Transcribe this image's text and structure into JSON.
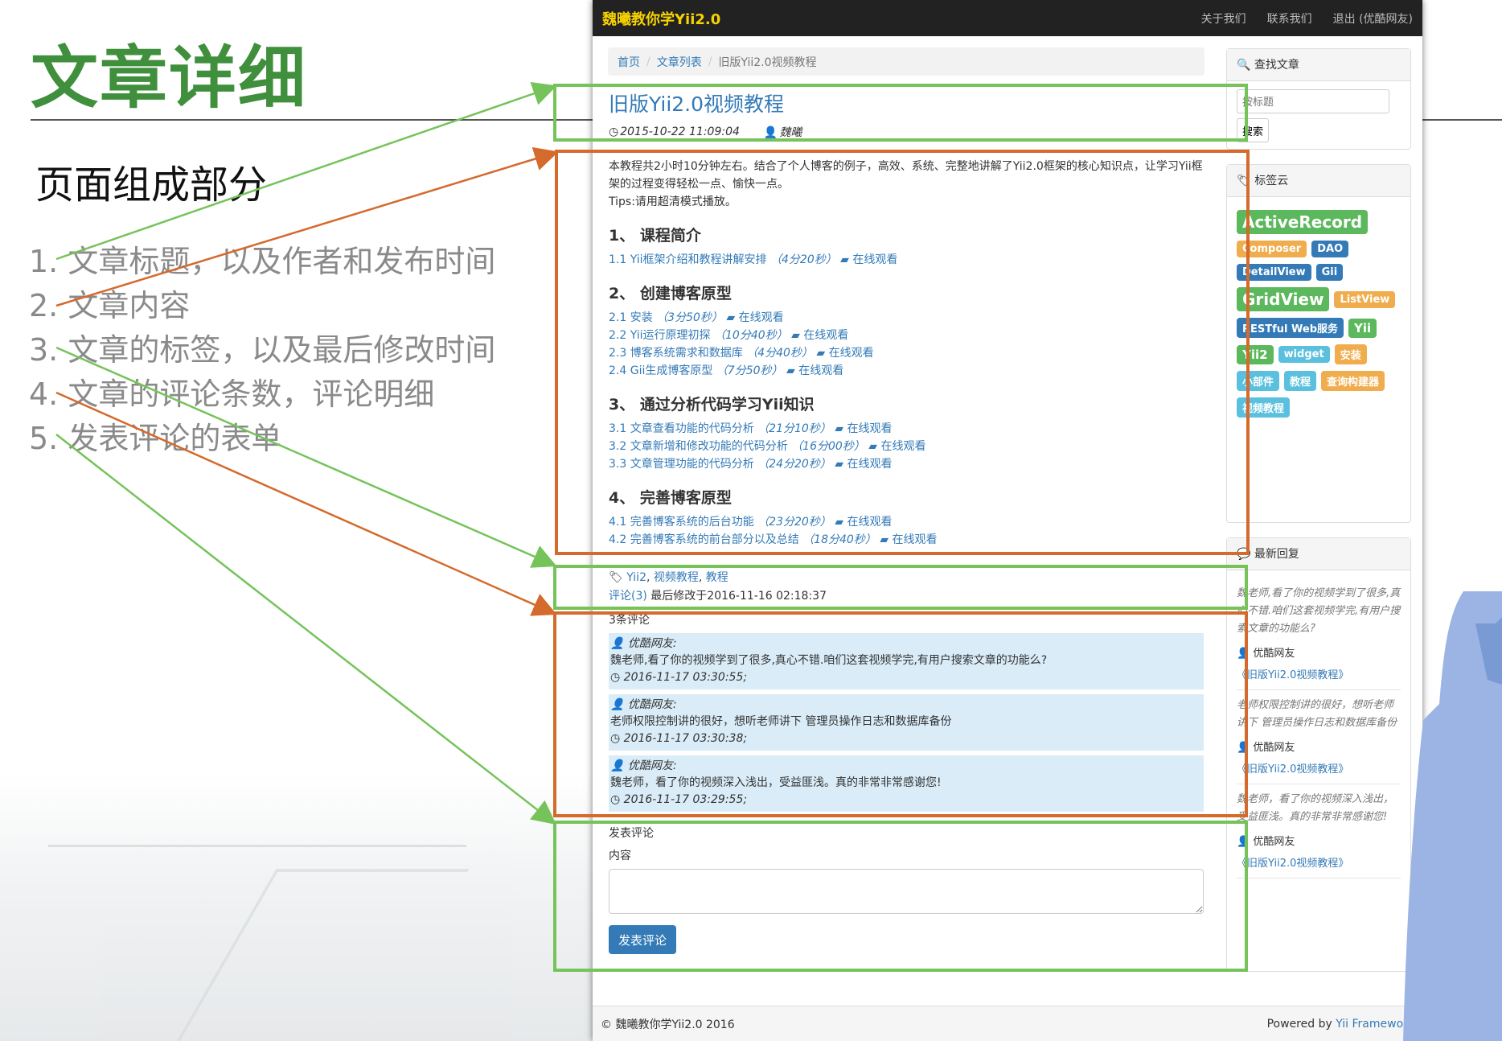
{
  "slide": {
    "title": "文章详细",
    "section_title": "页面组成部分",
    "points": [
      "1. 文章标题，以及作者和发布时间",
      "2. 文章内容",
      "3. 文章的标签，以及最后修改时间",
      "4. 文章的评论条数，评论明细",
      "5. 发表评论的表单"
    ]
  },
  "navbar": {
    "brand": "魏曦教你学Yii2.0",
    "links": [
      "关于我们",
      "联系我们",
      "退出 (优酷网友)"
    ]
  },
  "breadcrumb": {
    "items": [
      "首页",
      "文章列表"
    ],
    "current": "旧版Yii2.0视频教程"
  },
  "post": {
    "title": "旧版Yii2.0视频教程",
    "date": "2015-10-22 11:09:04",
    "author": "魏曦",
    "intro": "本教程共2小时10分钟左右。结合了个人博客的例子，高效、系统、完整地讲解了Yii2.0框架的核心知识点，让学习Yii框架的过程变得轻松一点、愉快一点。",
    "tips": "Tips:请用超清模式播放。",
    "watch_label": "在线观看",
    "sections": [
      {
        "heading": "1、 课程简介",
        "lessons": [
          {
            "title": "1.1 Yii框架介绍和教程讲解安排",
            "duration": "（4分20秒）"
          }
        ]
      },
      {
        "heading": "2、 创建博客原型",
        "lessons": [
          {
            "title": "2.1 安装",
            "duration": "（3分50秒）"
          },
          {
            "title": "2.2 Yii运行原理初探",
            "duration": "（10分40秒）"
          },
          {
            "title": "2.3 博客系统需求和数据库",
            "duration": "（4分40秒）"
          },
          {
            "title": "2.4 Gii生成博客原型",
            "duration": "（7分50秒）"
          }
        ]
      },
      {
        "heading": "3、 通过分析代码学习Yii知识",
        "lessons": [
          {
            "title": "3.1 文章查看功能的代码分析",
            "duration": "（21分10秒）"
          },
          {
            "title": "3.2 文章新增和修改功能的代码分析",
            "duration": "（16分00秒）"
          },
          {
            "title": "3.3 文章管理功能的代码分析",
            "duration": "（24分20秒）"
          }
        ]
      },
      {
        "heading": "4、 完善博客原型",
        "lessons": [
          {
            "title": "4.1 完善博客系统的后台功能",
            "duration": "（23分20秒）"
          },
          {
            "title": "4.2 完善博客系统的前台部分以及总结",
            "duration": "（18分40秒）"
          }
        ]
      }
    ],
    "tags": [
      "Yii2",
      "视频教程",
      "教程"
    ],
    "comment_link": "评论(3)",
    "last_modified": "最后修改于2016-11-16 02:18:37"
  },
  "comments": {
    "count_label": "3条评论",
    "items": [
      {
        "author": "优酷网友:",
        "text": "魏老师,看了你的视频学到了很多,真心不错.咱们这套视频学完,有用户搜索文章的功能么?",
        "time": "2016-11-17 03:30:55;"
      },
      {
        "author": "优酷网友:",
        "text": "老师权限控制讲的很好，想听老师讲下 管理员操作日志和数据库备份",
        "time": "2016-11-17 03:30:38;"
      },
      {
        "author": "优酷网友:",
        "text": "魏老师，看了你的视频深入浅出，受益匪浅。真的非常非常感谢您!",
        "time": "2016-11-17 03:29:55;"
      }
    ]
  },
  "comment_form": {
    "title": "发表评论",
    "content_label": "内容",
    "submit": "发表评论"
  },
  "sidebar": {
    "search": {
      "title": "查找文章",
      "placeholder": "按标题",
      "button": "搜索"
    },
    "tagcloud": {
      "title": "标签云",
      "tags": [
        {
          "name": "ActiveRecord",
          "color": "#5cb85c",
          "size": "s1"
        },
        {
          "name": "Composer",
          "color": "#f0ad4e",
          "size": "s3"
        },
        {
          "name": "DAO",
          "color": "#337ab7",
          "size": "s3"
        },
        {
          "name": "DetailView",
          "color": "#337ab7",
          "size": "s3"
        },
        {
          "name": "Gii",
          "color": "#337ab7",
          "size": "s3"
        },
        {
          "name": "GridView",
          "color": "#5cb85c",
          "size": "s1"
        },
        {
          "name": "ListView",
          "color": "#f0ad4e",
          "size": "s3"
        },
        {
          "name": "RESTful Web服务",
          "color": "#337ab7",
          "size": "s3"
        },
        {
          "name": "Yii",
          "color": "#5cb85c",
          "size": "s2"
        },
        {
          "name": "Yii2",
          "color": "#5cb85c",
          "size": "s2"
        },
        {
          "name": "widget",
          "color": "#5bc0de",
          "size": "s3"
        },
        {
          "name": "安装",
          "color": "#f0ad4e",
          "size": "s3"
        },
        {
          "name": "小部件",
          "color": "#5bc0de",
          "size": "s3"
        },
        {
          "name": "教程",
          "color": "#5bc0de",
          "size": "s3"
        },
        {
          "name": "查询构建器",
          "color": "#f0ad4e",
          "size": "s3"
        },
        {
          "name": "视频教程",
          "color": "#5bc0de",
          "size": "s3"
        }
      ]
    },
    "recent": {
      "title": "最新回复",
      "items": [
        {
          "text": "魏老师,看了你的视频学到了很多,真心不错.咱们这套视频学完,有用户搜索文章的功能么?",
          "author": "优酷网友",
          "link": "《旧版Yii2.0视频教程》"
        },
        {
          "text": "老师权限控制讲的很好，想听老师讲下 管理员操作日志和数据库备份",
          "author": "优酷网友",
          "link": "《旧版Yii2.0视频教程》"
        },
        {
          "text": "魏老师，看了你的视频深入浅出，受益匪浅。真的非常非常感谢您!",
          "author": "优酷网友",
          "link": "《旧版Yii2.0视频教程》"
        }
      ]
    }
  },
  "footer": {
    "copyright": "© 魏曦教你学Yii2.0 2016",
    "powered": "Powered by",
    "powered_link": "Yii Framework"
  },
  "colors": {
    "brand_green": "#3f8f3c",
    "annotation_green": "#76c35a",
    "annotation_orange": "#d46a2c",
    "link": "#337ab7"
  }
}
